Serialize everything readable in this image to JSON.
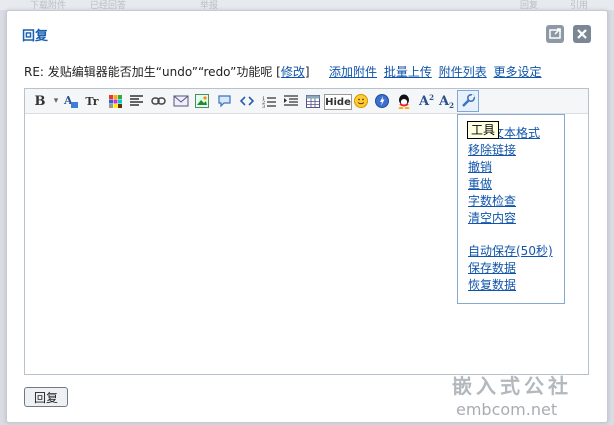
{
  "background_nav": [
    "下载附件",
    "已经回答",
    "举报",
    "回复",
    "引用"
  ],
  "dialog": {
    "title": "回复",
    "popout_icon": "popout-icon",
    "close_icon": "close-icon"
  },
  "subject": {
    "prefix": "RE: 发贴编辑器能否加生“undo”“redo”功能呢",
    "open_bracket": "[",
    "edit_link": "修改",
    "close_bracket": "]"
  },
  "links": [
    "添加附件",
    "批量上传",
    "附件列表",
    "更多设定"
  ],
  "toolbar": {
    "bold_label": "B",
    "dropdown_glyph": "▾",
    "tt_label": "Tr",
    "hide_label": "Hide",
    "superscript_label": "A",
    "subscript_label": "A",
    "icons": [
      "bold-icon",
      "font-color-icon",
      "font-size-icon",
      "color-grid-icon",
      "align-icon",
      "link-icon",
      "email-icon",
      "image-icon",
      "quote-icon",
      "code-icon",
      "ordered-list-icon",
      "indent-icon",
      "table-icon",
      "hide-icon",
      "emoticon-icon",
      "flash-icon",
      "qq-icon",
      "superscript-icon",
      "subscript-icon",
      "tools-icon"
    ]
  },
  "tooltip": "工具",
  "tools_menu": [
    "清除文本格式",
    "移除链接",
    "撤销",
    "重做",
    "字数检查",
    "清空内容",
    "自动保存(50秒)",
    "保存数据",
    "恢复数据"
  ],
  "reply_button": "回复",
  "watermark": {
    "line1": "嵌入式公社",
    "line2": "embcom.net"
  },
  "colors": {
    "title": "#195fb2",
    "link": "#1155aa",
    "menu_border": "#86a9d0",
    "tooltip_bg": "#ffffe1"
  }
}
